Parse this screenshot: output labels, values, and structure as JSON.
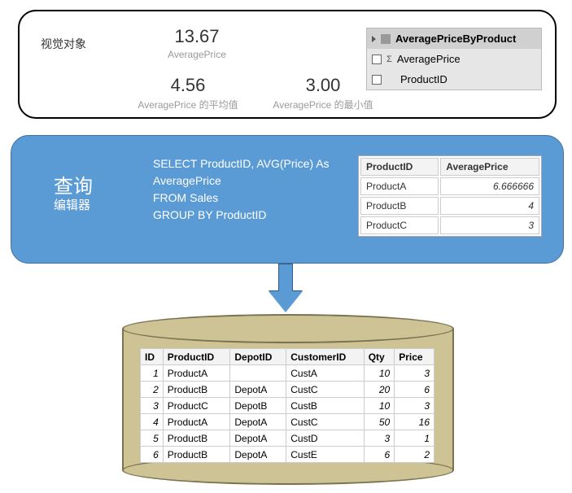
{
  "top": {
    "label": "视觉对象",
    "metrics": [
      {
        "value": "13.67",
        "label": "AveragePrice"
      },
      {
        "value": "4.56",
        "label": "AveragePrice 的平均值"
      },
      {
        "value": "3.00",
        "label": "AveragePrice 的最小值"
      }
    ],
    "fields": {
      "table": "AveragePriceByProduct",
      "cols": [
        "AveragePrice",
        "ProductID"
      ]
    }
  },
  "mid": {
    "title": "查询",
    "subtitle": "编辑器",
    "sql": {
      "l1": "SELECT ProductID, AVG(Price) As",
      "l2": "AveragePrice",
      "l3": "FROM Sales",
      "l4": "GROUP BY ProductID"
    },
    "result": {
      "headers": [
        "ProductID",
        "AveragePrice"
      ],
      "rows": [
        [
          "ProductA",
          "6.666666"
        ],
        [
          "ProductB",
          "4"
        ],
        [
          "ProductC",
          "3"
        ]
      ]
    }
  },
  "db": {
    "headers": [
      "ID",
      "ProductID",
      "DepotID",
      "CustomerID",
      "Qty",
      "Price"
    ],
    "rows": [
      [
        "1",
        "ProductA",
        "",
        "CustA",
        "10",
        "3"
      ],
      [
        "2",
        "ProductB",
        "DepotA",
        "CustC",
        "20",
        "6"
      ],
      [
        "3",
        "ProductC",
        "DepotB",
        "CustB",
        "10",
        "3"
      ],
      [
        "4",
        "ProductA",
        "DepotA",
        "CustC",
        "50",
        "16"
      ],
      [
        "5",
        "ProductB",
        "DepotA",
        "CustD",
        "3",
        "1"
      ],
      [
        "6",
        "ProductB",
        "DepotA",
        "CustE",
        "6",
        "2"
      ]
    ]
  }
}
